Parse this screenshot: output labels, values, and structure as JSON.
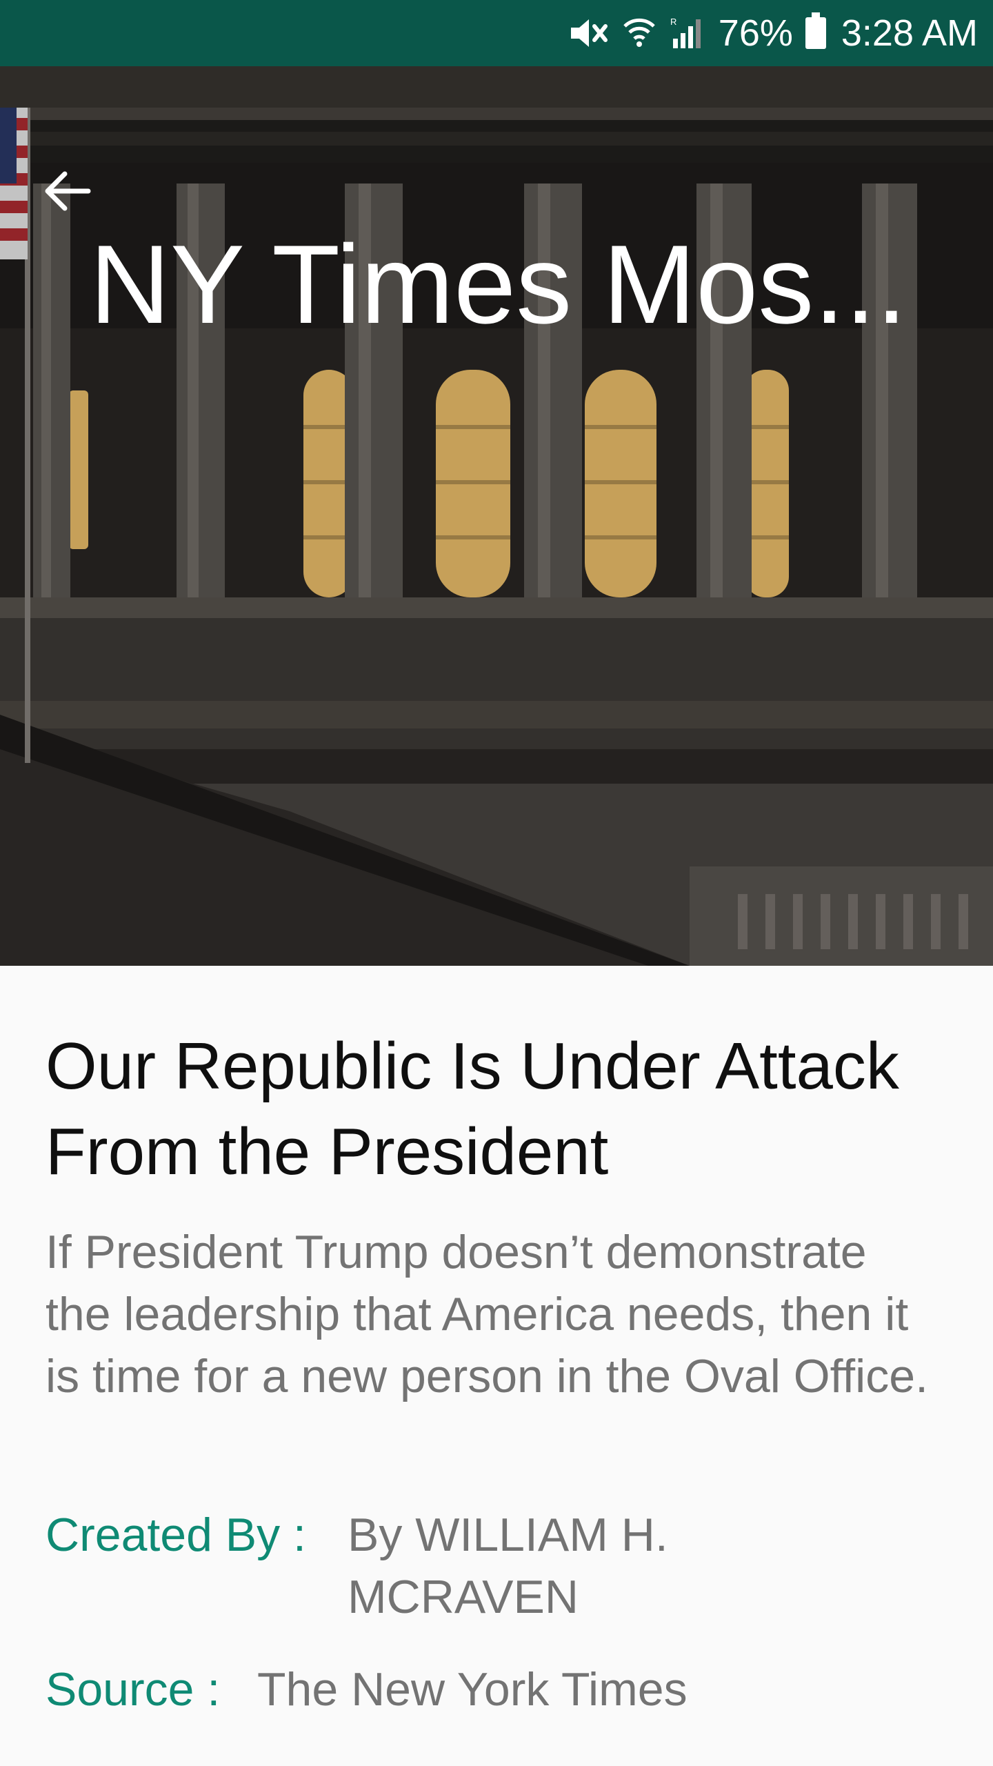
{
  "status_bar": {
    "battery": "76%",
    "time": "3:28 AM",
    "icons": [
      "mute-icon",
      "wifi-icon",
      "signal-icon",
      "battery-icon"
    ]
  },
  "toolbar": {
    "title": "NY Times Mos...",
    "back_icon": "arrow-left-icon"
  },
  "article": {
    "headline": "Our Republic Is Under Attack From the President",
    "description": "If President Trump doesn’t demonstrate the leadership that America needs, then it is time for a new person in the Oval Office.",
    "created_by_label": "Created By :",
    "created_by_value": "By WILLIAM H. MCRAVEN",
    "source_label": "Source :",
    "source_value": "The New York Times"
  },
  "colors": {
    "status_bar": "#0a574a",
    "accent": "#0f8a74",
    "secondary_text": "#737373"
  }
}
